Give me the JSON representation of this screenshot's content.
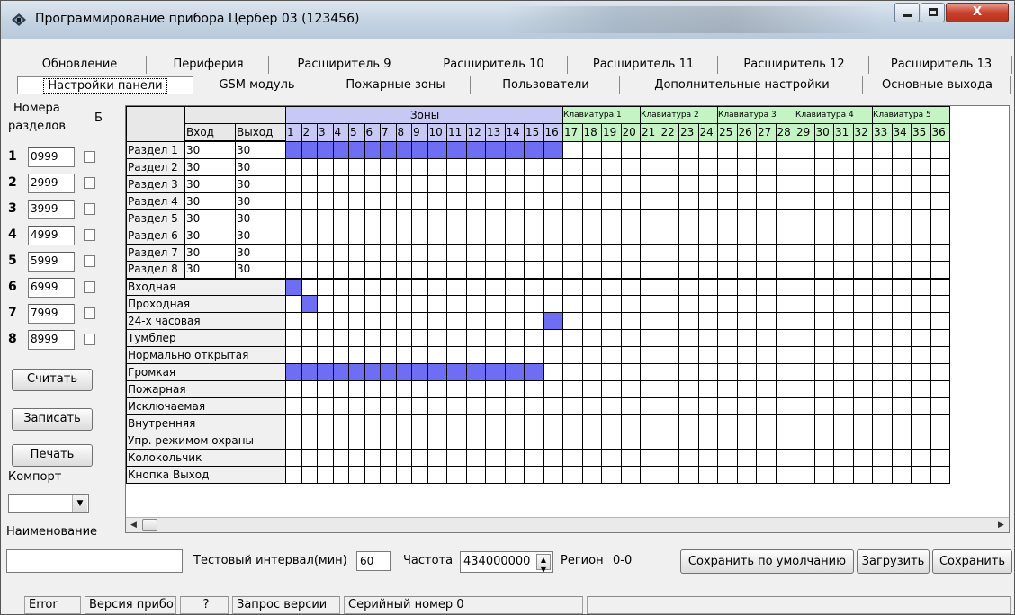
{
  "window": {
    "title": "Программирование прибора Цербер 03 (123456)",
    "buttons": {
      "close": "X"
    }
  },
  "tabs_row1": [
    "Обновление",
    "Периферия",
    "Расширитель 9",
    "Расширитель 10",
    "Расширитель 11",
    "Расширитель 12",
    "Расширитель 13"
  ],
  "tabs_row2": [
    "Настройки панели",
    "GSM модуль",
    "Пожарные зоны",
    "Пользователи",
    "Дополнительные настройки",
    "Основные выхода"
  ],
  "active_tab": "Настройки панели",
  "sections": {
    "header_line1": "Номера",
    "header_line2": "разделов",
    "header_b": "Б",
    "rows": [
      {
        "num": "1",
        "code": "0999"
      },
      {
        "num": "2",
        "code": "2999"
      },
      {
        "num": "3",
        "code": "3999"
      },
      {
        "num": "4",
        "code": "4999"
      },
      {
        "num": "5",
        "code": "5999"
      },
      {
        "num": "6",
        "code": "6999"
      },
      {
        "num": "7",
        "code": "7999"
      },
      {
        "num": "8",
        "code": "8999"
      }
    ]
  },
  "buttons": {
    "read": "Считать",
    "write": "Записать",
    "print": "Печать",
    "save_default": "Сохранить по умолчанию",
    "load": "Загрузить",
    "save": "Сохранить"
  },
  "labels": {
    "comport": "Компорт",
    "name": "Наименование",
    "test_interval": "Тестовый интервал(мин)",
    "frequency": "Частота",
    "region": "Регион",
    "region_value": "0-0"
  },
  "fields": {
    "test_interval": "60",
    "frequency": "434000000",
    "name": "",
    "comport": ""
  },
  "grid": {
    "col_in": "Вход",
    "col_out": "Выход",
    "zones_header": "Зоны",
    "keypads": [
      "Клавиатура 1",
      "Клавиатура 2",
      "Клавиатура 3",
      "Клавиатура 4",
      "Клавиатура 5"
    ],
    "zone_numbers": [
      "1",
      "2",
      "3",
      "4",
      "5",
      "6",
      "7",
      "8",
      "9",
      "10",
      "11",
      "12",
      "13",
      "14",
      "15",
      "16",
      "17",
      "18",
      "19",
      "20",
      "21",
      "22",
      "23",
      "24",
      "25",
      "26",
      "27",
      "28",
      "29",
      "30",
      "31",
      "32",
      "33",
      "34",
      "35",
      "36"
    ],
    "partitions": [
      {
        "name": "Раздел 1",
        "in": "30",
        "out": "30",
        "on": [
          1,
          2,
          3,
          4,
          5,
          6,
          7,
          8,
          9,
          10,
          11,
          12,
          13,
          14,
          15,
          16
        ]
      },
      {
        "name": "Раздел 2",
        "in": "30",
        "out": "30",
        "on": []
      },
      {
        "name": "Раздел 3",
        "in": "30",
        "out": "30",
        "on": []
      },
      {
        "name": "Раздел 4",
        "in": "30",
        "out": "30",
        "on": []
      },
      {
        "name": "Раздел 5",
        "in": "30",
        "out": "30",
        "on": []
      },
      {
        "name": "Раздел 6",
        "in": "30",
        "out": "30",
        "on": []
      },
      {
        "name": "Раздел 7",
        "in": "30",
        "out": "30",
        "on": []
      },
      {
        "name": "Раздел 8",
        "in": "30",
        "out": "30",
        "on": []
      }
    ],
    "zone_types": [
      {
        "name": "Входная",
        "on": [
          1
        ]
      },
      {
        "name": "Проходная",
        "on": [
          2
        ]
      },
      {
        "name": "24-х часовая",
        "on": [
          16
        ]
      },
      {
        "name": "Тумблер",
        "on": []
      },
      {
        "name": "Нормально открытая",
        "on": []
      },
      {
        "name": "Громкая",
        "on": [
          1,
          2,
          3,
          4,
          5,
          6,
          7,
          8,
          9,
          10,
          11,
          12,
          13,
          14,
          15
        ]
      },
      {
        "name": "Пожарная",
        "on": []
      },
      {
        "name": "Исключаемая",
        "on": []
      },
      {
        "name": "Внутренняя",
        "on": []
      },
      {
        "name": "Упр. режимом охраны",
        "on": []
      },
      {
        "name": "Колокольчик",
        "on": []
      },
      {
        "name": "Кнопка Выход",
        "on": []
      }
    ]
  },
  "statusbar": [
    "Error",
    "Версия прибора",
    "?",
    "Запрос версии",
    "Серийный номер 0",
    ""
  ],
  "colors": {
    "zone_header": "#c8c8f4",
    "keypad_header": "#c4f4c4",
    "selected_cell": "#6e6ef4"
  }
}
